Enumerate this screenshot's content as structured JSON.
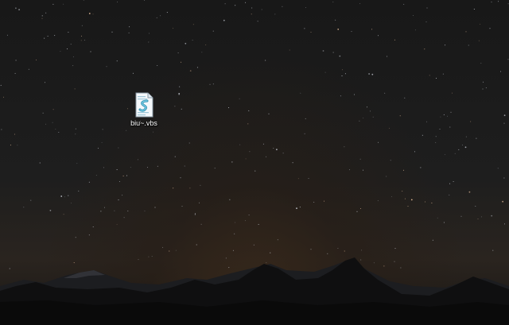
{
  "desktop": {
    "icons": [
      {
        "label": "biu~.vbs",
        "icon": "vbs-script-icon"
      }
    ]
  },
  "colors": {
    "sky_top": "#181818",
    "horizon_glow": "#3a2a1c",
    "mountain_dark": "#0c0c0c",
    "mountain_far": "#1b1c1f",
    "icon_page": "#f4f8fb",
    "icon_accent": "#3fa9c9"
  }
}
